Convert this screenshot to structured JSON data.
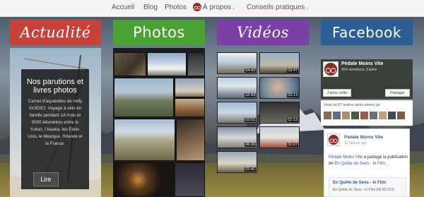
{
  "nav": {
    "items": [
      {
        "label": "Accueil"
      },
      {
        "label": "Blog"
      },
      {
        "label": "Photos"
      },
      {
        "label": "À propos"
      },
      {
        "label": "Conseils pratiques"
      }
    ],
    "caret": "⌄"
  },
  "columns": {
    "actualite": "Actualité",
    "photos": "Photos",
    "videos": "Vidéos",
    "facebook": "Facebook"
  },
  "actualite": {
    "title": "Nos parutions et livres photos",
    "description": "Carnet d'aquarelles de nelly GUIDICI. Voyage à vélo en famille pendant 14 mois et 9000 kilomètres entre le Yukon, l'Alaska, les Etats-Unis, le Mexique, l'Irlande et la France.",
    "button": "Lire"
  },
  "videos": {
    "durations": [
      "04:42",
      "03:47",
      "02:43",
      "03:13",
      "03:51",
      "02:13",
      "06:34",
      "02:07",
      "02:41"
    ]
  },
  "facebook": {
    "page_name": "Pédale Moins Vite",
    "mentions": "204 mentions J'aime",
    "like_button": "J'aime cette",
    "share_button": "Partager",
    "friends_text": "Vous et 87 autres amis aimez ça",
    "post": {
      "author": "Pédale Moins Vite",
      "time": "12 heures ago",
      "text_prefix": "Pédale Moins Vite",
      "text_middle": " a partagé la publication de ",
      "text_link": "En Quête de Sens - le Film",
      "text_suffix": ".",
      "link_title": "En Quête de Sens - le Film",
      "link_desc": "En Quête de Sens - le Film EN ACCES"
    }
  },
  "colors": {
    "actualite": "#c6423a",
    "photos": "#4aa232",
    "videos": "#7b3fa8",
    "facebook": "#2b5f95"
  }
}
